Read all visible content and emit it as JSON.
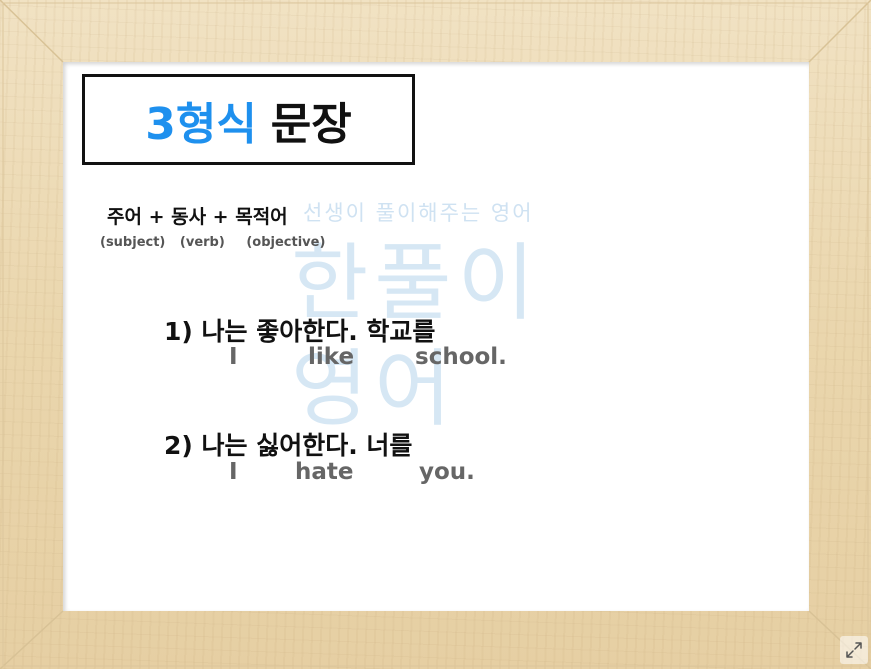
{
  "title": {
    "number": "3형식",
    "text": "문장"
  },
  "formula": {
    "text": "주어 + 동사 + 목적어",
    "roles": [
      "(subject)",
      "(verb)",
      "(objective)"
    ]
  },
  "watermark": {
    "top": "선생이 풀이해주는 영어",
    "line1": "한풀이",
    "line2": "영어"
  },
  "sentences": [
    {
      "korean": "1) 나는  좋아한다. 학교를",
      "english": [
        "I",
        "like",
        "school."
      ]
    },
    {
      "korean": "2) 나는 싫어한다.  너를",
      "english": [
        "I",
        "hate",
        "you."
      ]
    }
  ],
  "controls": {
    "expand_icon": "expand-icon"
  },
  "colors": {
    "accent": "#1e90ee",
    "frame": "#ead6ad",
    "watermark": "#d6e7f4"
  }
}
